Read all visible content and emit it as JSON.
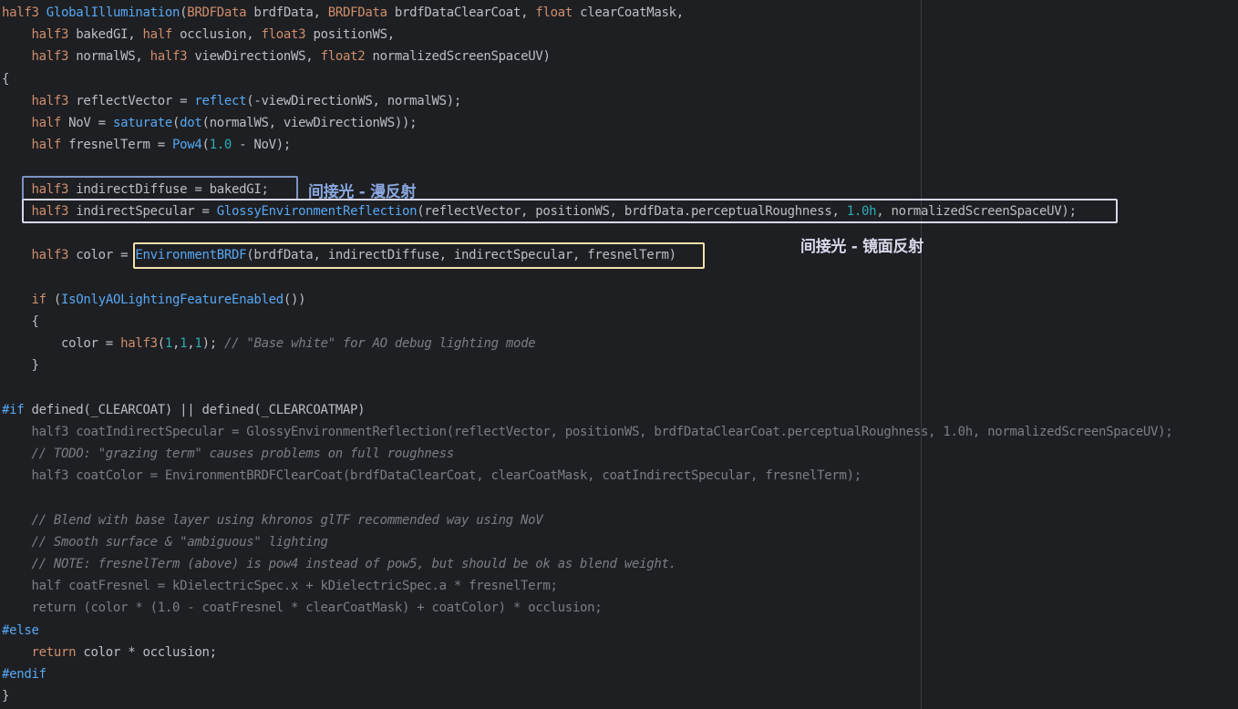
{
  "editor": {
    "lines": [
      {
        "text": "half3 GlobalIllumination(BRDFData brdfData, BRDFData brdfDataClearCoat, float clearCoatMask,",
        "kind": "sig"
      },
      {
        "text": "    half3 bakedGI, half occlusion, float3 positionWS,",
        "kind": "sig"
      },
      {
        "text": "    half3 normalWS, half3 viewDirectionWS, float2 normalizedScreenSpaceUV)",
        "kind": "sig"
      },
      {
        "text": "{",
        "kind": "plain"
      },
      {
        "text": "    half3 reflectVector = reflect(-viewDirectionWS, normalWS);",
        "kind": "code"
      },
      {
        "text": "    half NoV = saturate(dot(normalWS, viewDirectionWS));",
        "kind": "code"
      },
      {
        "text": "    half fresnelTerm = Pow4(1.0 - NoV);",
        "kind": "code"
      },
      {
        "text": "",
        "kind": "plain"
      },
      {
        "text": "    half3 indirectDiffuse = bakedGI;",
        "kind": "code"
      },
      {
        "text": "    half3 indirectSpecular = GlossyEnvironmentReflection(reflectVector, positionWS, brdfData.perceptualRoughness, 1.0h, normalizedScreenSpaceUV);",
        "kind": "code"
      },
      {
        "text": "",
        "kind": "plain"
      },
      {
        "text": "    half3 color = EnvironmentBRDF(brdfData, indirectDiffuse, indirectSpecular, fresnelTerm)",
        "kind": "code"
      },
      {
        "text": "",
        "kind": "plain"
      },
      {
        "text": "    if (IsOnlyAOLightingFeatureEnabled())",
        "kind": "code"
      },
      {
        "text": "    {",
        "kind": "plain"
      },
      {
        "text": "        color = half3(1,1,1); // \"Base white\" for AO debug lighting mode",
        "kind": "code"
      },
      {
        "text": "    }",
        "kind": "plain"
      },
      {
        "text": "",
        "kind": "plain"
      },
      {
        "text": "#if defined(_CLEARCOAT) || defined(_CLEARCOATMAP)",
        "kind": "dir"
      },
      {
        "text": "    half3 coatIndirectSpecular = GlossyEnvironmentReflection(reflectVector, positionWS, brdfDataClearCoat.perceptualRoughness, 1.0h, normalizedScreenSpaceUV);",
        "kind": "dim"
      },
      {
        "text": "    // TODO: \"grazing term\" causes problems on full roughness",
        "kind": "comment"
      },
      {
        "text": "    half3 coatColor = EnvironmentBRDFClearCoat(brdfDataClearCoat, clearCoatMask, coatIndirectSpecular, fresnelTerm);",
        "kind": "dim"
      },
      {
        "text": "",
        "kind": "plain"
      },
      {
        "text": "    // Blend with base layer using khronos glTF recommended way using NoV",
        "kind": "comment"
      },
      {
        "text": "    // Smooth surface & \"ambiguous\" lighting",
        "kind": "comment"
      },
      {
        "text": "    // NOTE: fresnelTerm (above) is pow4 instead of pow5, but should be ok as blend weight.",
        "kind": "comment"
      },
      {
        "text": "    half coatFresnel = kDielectricSpec.x + kDielectricSpec.a * fresnelTerm;",
        "kind": "dim"
      },
      {
        "text": "    return (color * (1.0 - coatFresnel * clearCoatMask) + coatColor) * occlusion;",
        "kind": "dim"
      },
      {
        "text": "#else",
        "kind": "dir"
      },
      {
        "text": "    return color * occlusion;",
        "kind": "code"
      },
      {
        "text": "#endif",
        "kind": "dir"
      },
      {
        "text": "}",
        "kind": "plain"
      }
    ]
  },
  "annotations": {
    "diffuse_label": "间接光 - 漫反射",
    "specular_label": "间接光 - 镜面反射"
  },
  "colors": {
    "background": "#1e1f22",
    "keyword_type": "#cf8e6d",
    "function": "#56a8f5",
    "number": "#2aacb8",
    "comment": "#7a7e85",
    "box_diffuse": "#7b93c6",
    "box_specular": "#d8d8f0",
    "box_brdf": "#f3e2a9"
  }
}
